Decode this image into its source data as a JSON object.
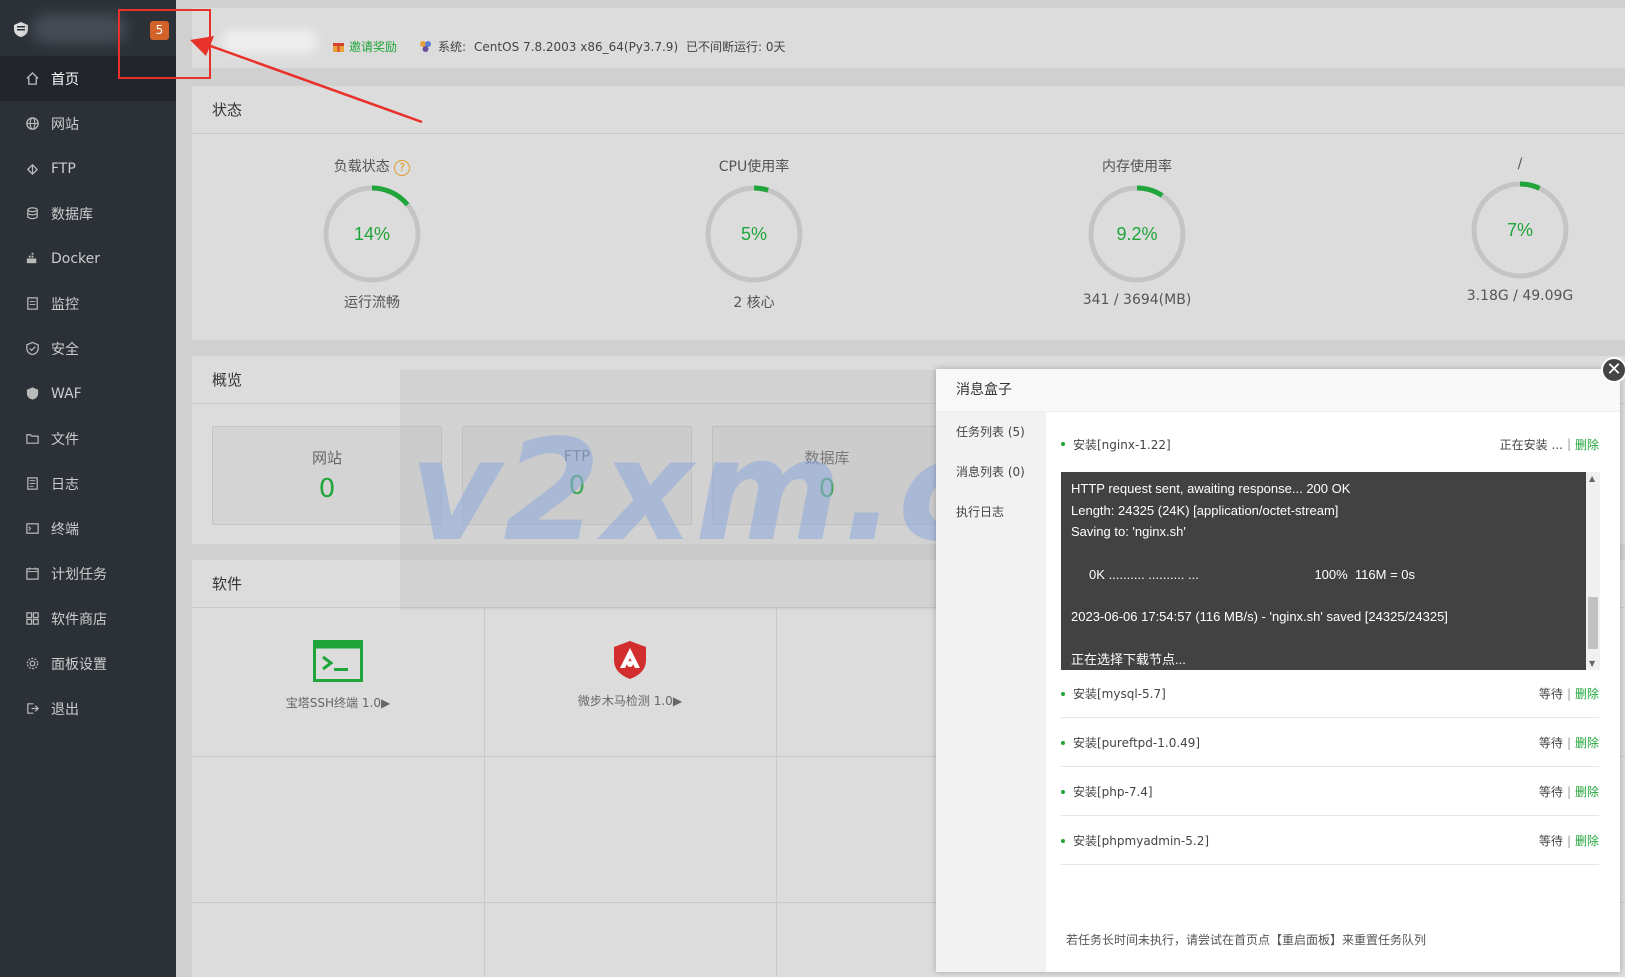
{
  "sidebar": {
    "badge": "5",
    "items": [
      {
        "label": "首页",
        "icon": "home-icon"
      },
      {
        "label": "网站",
        "icon": "globe-icon"
      },
      {
        "label": "FTP",
        "icon": "ftp-icon"
      },
      {
        "label": "数据库",
        "icon": "database-icon"
      },
      {
        "label": "Docker",
        "icon": "docker-icon"
      },
      {
        "label": "监控",
        "icon": "monitor-icon"
      },
      {
        "label": "安全",
        "icon": "shield-icon"
      },
      {
        "label": "WAF",
        "icon": "waf-icon"
      },
      {
        "label": "文件",
        "icon": "folder-icon"
      },
      {
        "label": "日志",
        "icon": "log-icon"
      },
      {
        "label": "终端",
        "icon": "terminal-icon"
      },
      {
        "label": "计划任务",
        "icon": "calendar-icon"
      },
      {
        "label": "软件商店",
        "icon": "apps-icon"
      },
      {
        "label": "面板设置",
        "icon": "gear-icon"
      },
      {
        "label": "退出",
        "icon": "logout-icon"
      }
    ]
  },
  "topbar": {
    "invite": "邀请奖励",
    "system_label": "系统:",
    "system_value": "CentOS 7.8.2003 x86_64(Py3.7.9)",
    "uptime": "已不间断运行: 0天"
  },
  "status": {
    "title": "状态",
    "gauges": [
      {
        "label": "负载状态",
        "value": "14%",
        "percent": 14,
        "sub": "运行流畅",
        "help": "?"
      },
      {
        "label": "CPU使用率",
        "value": "5%",
        "percent": 5,
        "sub": "2 核心"
      },
      {
        "label": "内存使用率",
        "value": "9.2%",
        "percent": 9.2,
        "sub": "341 / 3694(MB)"
      },
      {
        "label": "/",
        "value": "7%",
        "percent": 7,
        "sub": "3.18G / 49.09G"
      }
    ]
  },
  "overview": {
    "title": "概览",
    "boxes": [
      {
        "label": "网站",
        "value": "0"
      },
      {
        "label": "FTP",
        "value": "0"
      },
      {
        "label": "数据库",
        "value": "0"
      }
    ]
  },
  "software": {
    "title": "软件",
    "items": [
      {
        "name": "宝塔SSH终端 1.0▶",
        "icon": "terminal-app-icon"
      },
      {
        "name": "微步木马检测 1.0▶",
        "icon": "trojan-detect-icon"
      }
    ]
  },
  "watermark": "v2xm.com",
  "dialog": {
    "title": "消息盒子",
    "close": "✕",
    "tabs": [
      "任务列表 (5)",
      "消息列表 (0)",
      "执行日志"
    ],
    "tasks": [
      {
        "name": "安装[nginx-1.22]",
        "status": "正在安装 ...",
        "delete": "删除"
      },
      {
        "name": "安装[mysql-5.7]",
        "status": "等待",
        "delete": "删除"
      },
      {
        "name": "安装[pureftpd-1.0.49]",
        "status": "等待",
        "delete": "删除"
      },
      {
        "name": "安装[php-7.4]",
        "status": "等待",
        "delete": "删除"
      },
      {
        "name": "安装[phpmyadmin-5.2]",
        "status": "等待",
        "delete": "删除"
      }
    ],
    "separator": "|",
    "console": [
      "HTTP request sent, awaiting response... 200 OK",
      "Length: 24325 (24K) [application/octet-stream]",
      "Saving to: 'nginx.sh'",
      "",
      "     0K .......... .......... ...                                100%  116M = 0s",
      "",
      "2023-06-06 17:54:57 (116 MB/s) - 'nginx.sh' saved [24325/24325]",
      "",
      "正在选择下载节点..."
    ],
    "note": "若任务长时间未执行，请尝试在首页点【重启面板】来重置任务队列"
  }
}
